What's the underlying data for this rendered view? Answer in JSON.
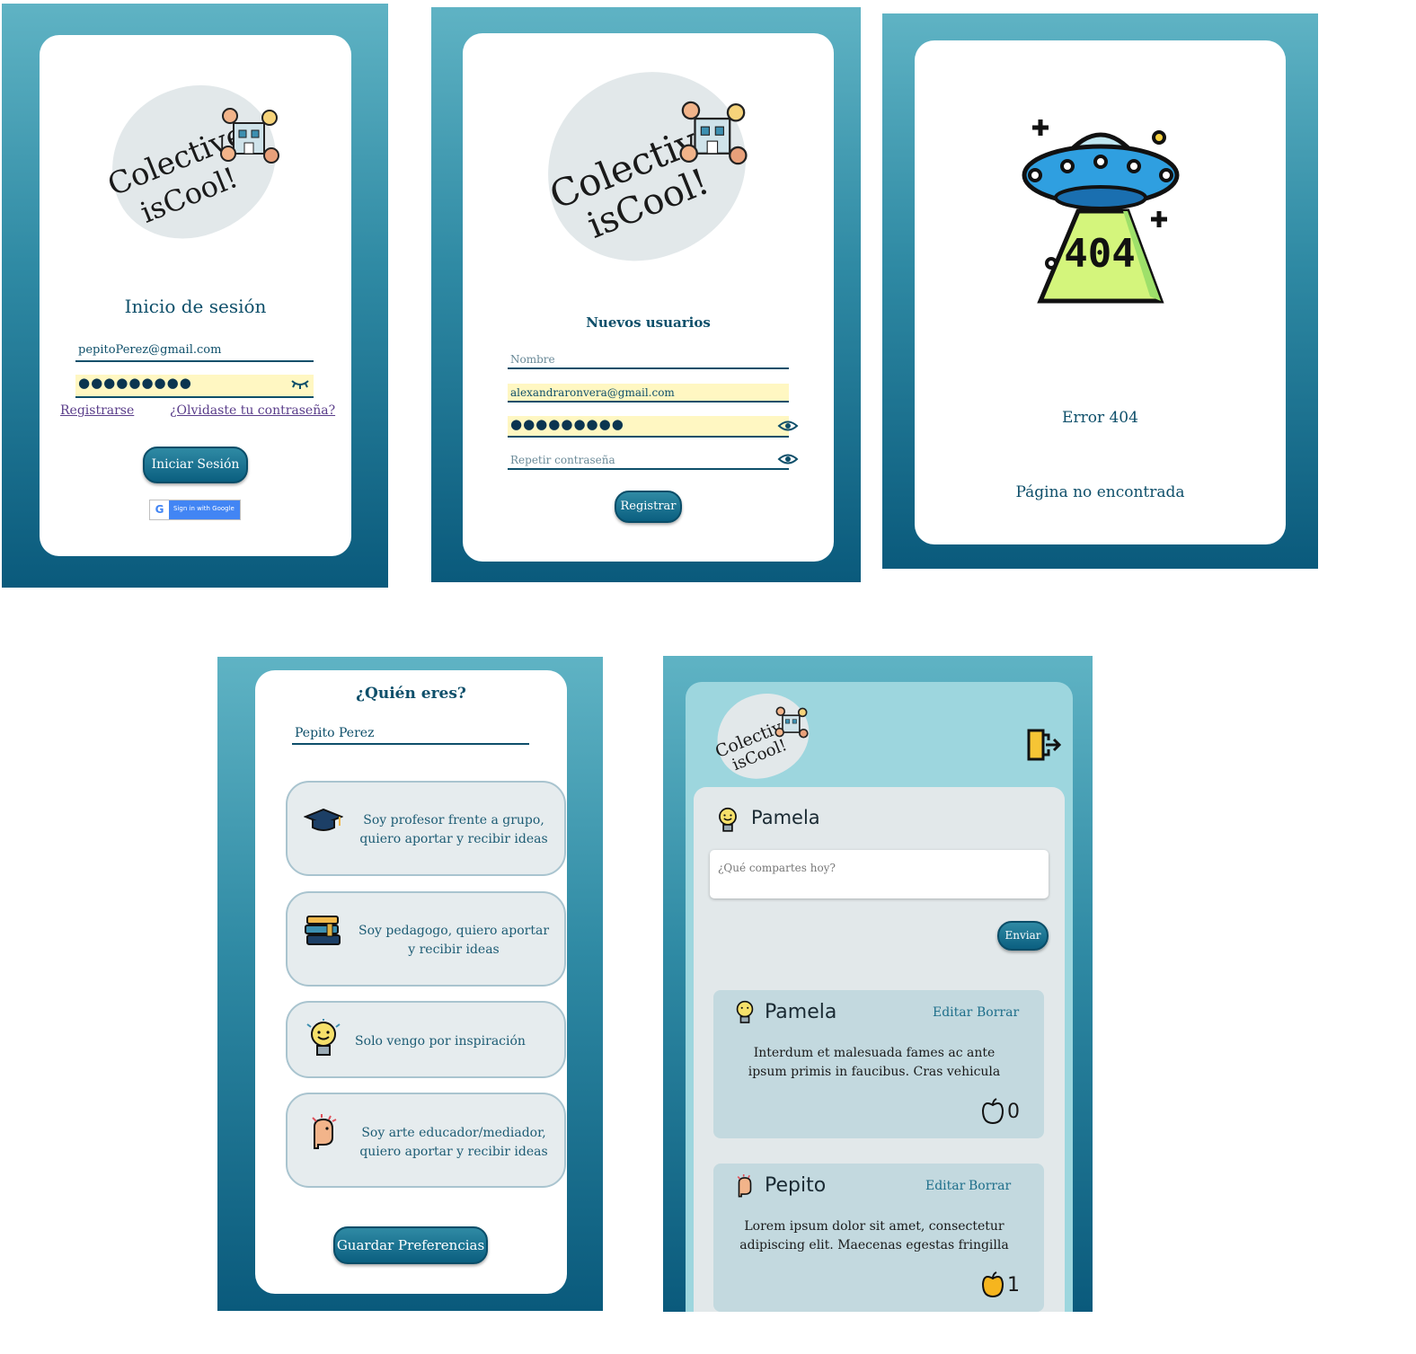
{
  "logo": {
    "line1": "Colective",
    "line2": "isCool!"
  },
  "login": {
    "title": "Inicio de sesión",
    "email_value": "pepitoPerez@gmail.com",
    "password_mask": "●●●●●●●●●",
    "register_link": "Registrarse",
    "forgot_link": "¿Olvidaste tu contraseña?",
    "submit_label": "Iniciar Sesión",
    "google_label": "Sign in with Google"
  },
  "register": {
    "title": "Nuevos usuarios",
    "name_placeholder": "Nombre",
    "email_value": "alexandraronvera@gmail.com",
    "password_mask": "●●●●●●●●●",
    "repeat_placeholder": "Repetir contraseña",
    "submit_label": "Registrar"
  },
  "error": {
    "image_text": "404",
    "title": "Error 404",
    "subtitle": "Página no encontrada"
  },
  "profile": {
    "title": "¿Quién eres?",
    "name_value": "Pepito Perez",
    "options": [
      {
        "icon": "graduation-cap-icon",
        "line1": "Soy profesor frente a grupo,",
        "line2": "quiero aportar y recibir ideas"
      },
      {
        "icon": "books-icon",
        "line1": "Soy pedagogo, quiero aportar",
        "line2": "y recibir ideas"
      },
      {
        "icon": "lightbulb-icon",
        "line1": "Solo vengo por inspiración",
        "line2": ""
      },
      {
        "icon": "artist-head-icon",
        "line1": "Soy arte educador/mediador,",
        "line2": "quiero aportar y recibir ideas"
      }
    ],
    "save_label": "Guardar Preferencias"
  },
  "feed": {
    "current_user": "Pamela",
    "compose_placeholder": "¿Qué compartes hoy?",
    "send_label": "Enviar",
    "posts": [
      {
        "author": "Pamela",
        "edit": "Editar",
        "delete": "Borrar",
        "line1": "Interdum et malesuada fames ac ante",
        "line2": "ipsum primis in faucibus. Cras vehicula",
        "likes": "0"
      },
      {
        "author": "Pepito",
        "edit": "Editar",
        "delete": "Borrar",
        "line1": "Lorem ipsum dolor sit amet, consectetur",
        "line2": "adipiscing elit. Maecenas egestas fringilla",
        "likes": "1"
      }
    ]
  }
}
